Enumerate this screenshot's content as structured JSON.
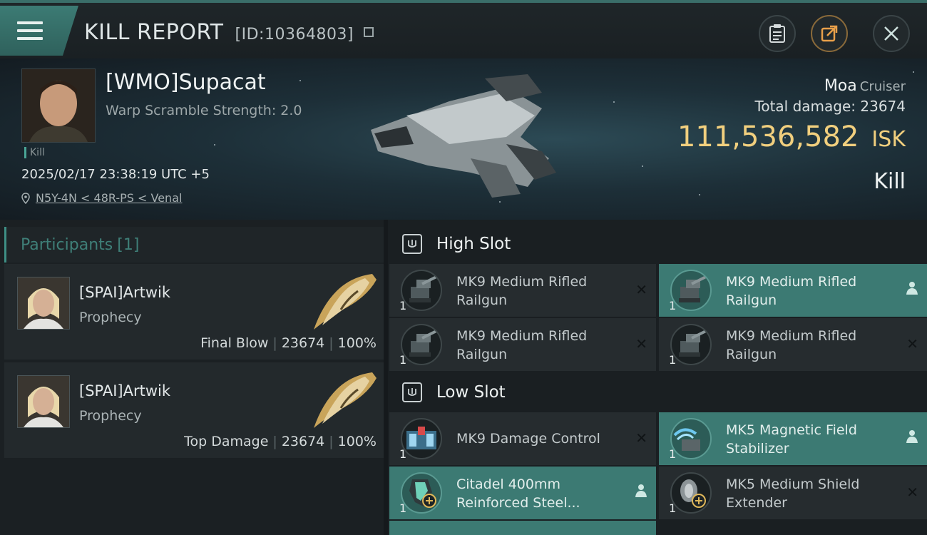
{
  "header": {
    "title": "KILL REPORT",
    "report_id": "[ID:10364803]"
  },
  "victim": {
    "name": "[WMO]Supacat",
    "warp_scramble": "Warp Scramble Strength: 2.0",
    "kill_tag": "Kill",
    "datetime": "2025/02/17 23:38:19 UTC +5",
    "location": "N5Y-4N < 48R-PS < Venal"
  },
  "ship": {
    "name": "Moa",
    "class": "Cruiser",
    "total_damage_label": "Total damage:",
    "total_damage": "23674",
    "isk_value": "111,536,582",
    "isk_unit": "ISK",
    "result": "Kill"
  },
  "participants": {
    "label": "Participants",
    "count": "[1]",
    "items": [
      {
        "name": "[SPAI]Artwik",
        "ship": "Prophecy",
        "role": "Final Blow",
        "damage": "23674",
        "percent": "100%"
      },
      {
        "name": "[SPAI]Artwik",
        "ship": "Prophecy",
        "role": "Top Damage",
        "damage": "23674",
        "percent": "100%"
      }
    ]
  },
  "slots": {
    "high": {
      "label": "High Slot",
      "modules": [
        {
          "name": "MK9 Medium Rifled Railgun",
          "qty": "1",
          "status": "destroyed"
        },
        {
          "name": "MK9 Medium Rifled Railgun",
          "qty": "1",
          "status": "dropped"
        },
        {
          "name": "MK9 Medium Rifled Railgun",
          "qty": "1",
          "status": "destroyed"
        },
        {
          "name": "MK9 Medium Rifled Railgun",
          "qty": "1",
          "status": "destroyed"
        }
      ]
    },
    "low": {
      "label": "Low Slot",
      "modules": [
        {
          "name": "MK9 Damage Control",
          "qty": "1",
          "status": "destroyed"
        },
        {
          "name": "MK5 Magnetic Field Stabilizer",
          "qty": "1",
          "status": "dropped"
        },
        {
          "name": "Citadel 400mm Reinforced Steel...",
          "qty": "1",
          "status": "dropped"
        },
        {
          "name": "MK5 Medium Shield Extender",
          "qty": "1",
          "status": "destroyed"
        }
      ]
    }
  },
  "colors": {
    "accent_teal": "#3c7a73",
    "isk_gold": "#f1cf7e"
  }
}
